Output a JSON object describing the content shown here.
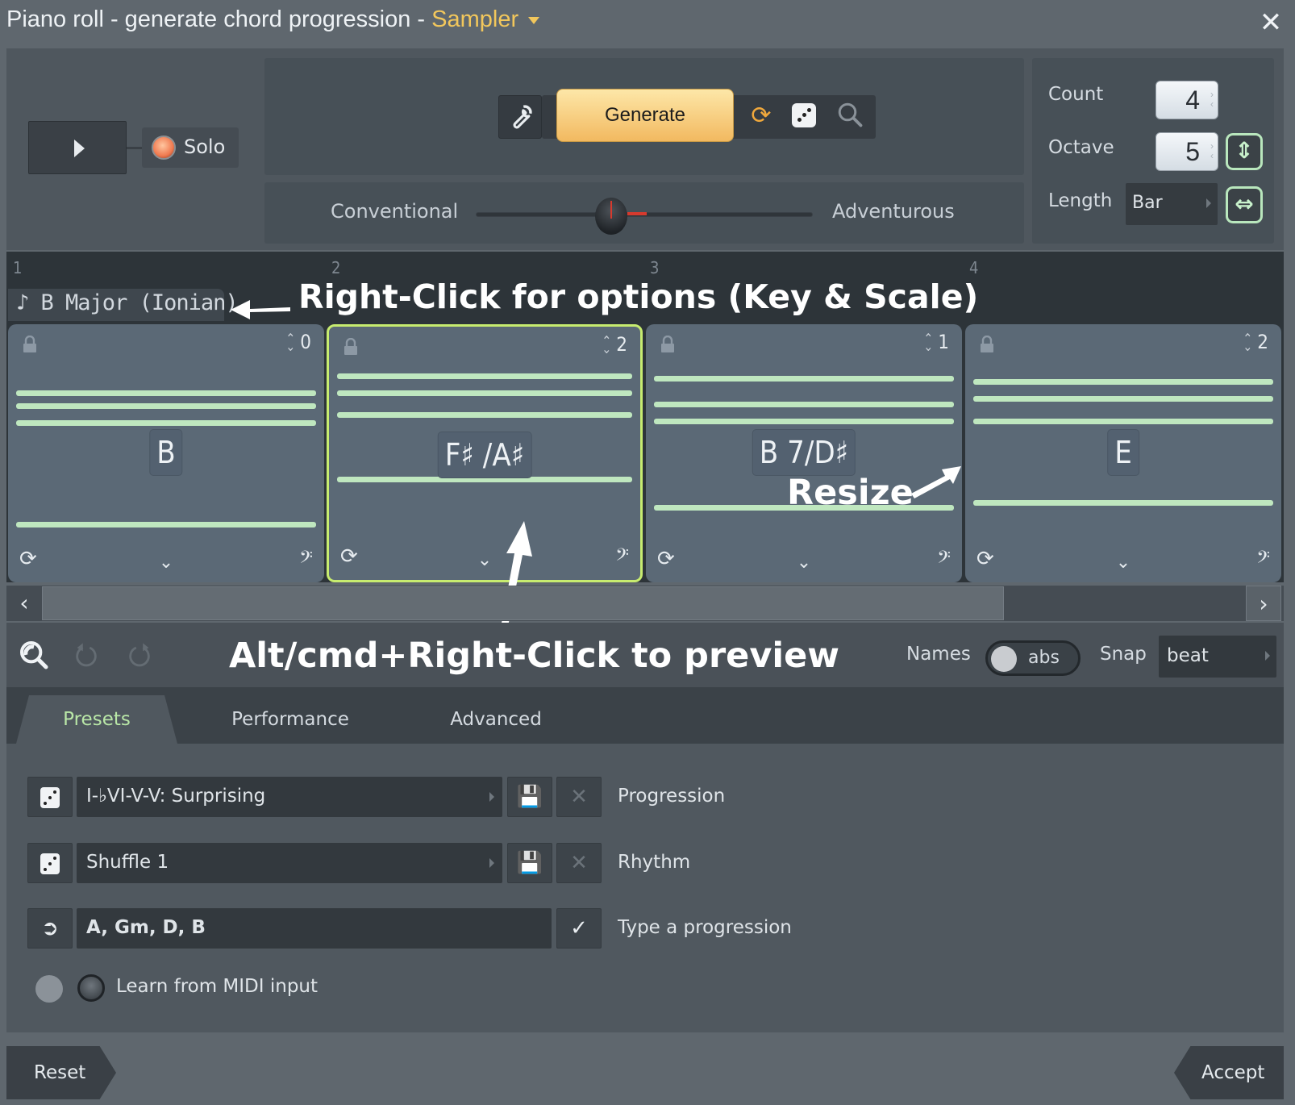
{
  "window": {
    "title": "Piano roll - generate chord progression - ",
    "plugin": "Sampler",
    "close_icon": "close-icon"
  },
  "transport": {
    "play_icon": "play-icon",
    "solo_label": "Solo"
  },
  "generator": {
    "settings_icon": "wrench-icon",
    "generate_label": "Generate",
    "refresh_icon": "refresh-icon",
    "dice_icon": "dice-icon",
    "preview_icon": "magnifier-icon",
    "slider_left_label": "Conventional",
    "slider_right_label": "Adventurous",
    "adventurousness_value": 0.38
  },
  "params": {
    "count_label": "Count",
    "count_value": "4",
    "octave_label": "Octave",
    "octave_value": "5",
    "length_label": "Length",
    "length_value": "Bar",
    "octave_lock_icon": "vertical-arrows-icon",
    "length_lock_icon": "horizontal-arrows-icon"
  },
  "timeline": {
    "bar_numbers": [
      "1",
      "2",
      "3",
      "4"
    ],
    "key_scale": "B Major (Ionian)",
    "key_icon": "eighth-note-icon"
  },
  "chords": [
    {
      "name": "B",
      "inversion": "0",
      "selected": false
    },
    {
      "name": "F♯ /A♯",
      "inversion": "2",
      "selected": true
    },
    {
      "name": "B 7/D♯",
      "inversion": "1",
      "selected": false
    },
    {
      "name": "E",
      "inversion": "2",
      "selected": false
    }
  ],
  "annotations": {
    "right_click": "Right-Click for options (Key & Scale)",
    "resize": "Resize",
    "alt_click": "Alt/cmd+Right-Click to preview"
  },
  "toolbar": {
    "names_label": "Names",
    "names_toggle_value": "abs",
    "snap_label": "Snap",
    "snap_value": "beat"
  },
  "tabs": [
    {
      "label": "Presets",
      "active": true
    },
    {
      "label": "Performance",
      "active": false
    },
    {
      "label": "Advanced",
      "active": false
    }
  ],
  "presets": {
    "progression_value": "I-♭VI-V-V: Surprising",
    "progression_label": "Progression",
    "rhythm_value": "Shuffle 1",
    "rhythm_label": "Rhythm",
    "typed_value": "A, Gm, D, B",
    "typed_label": "Type a progression",
    "midi_label": "Learn from MIDI input"
  },
  "footer": {
    "reset_label": "Reset",
    "accept_label": "Accept"
  },
  "colors": {
    "accent_generate": "#f2b960",
    "plugin_name": "#f2c75c",
    "note_green": "#bfe7bf",
    "selected_border": "#c7ec6f",
    "slider_red": "#d63a2e"
  }
}
